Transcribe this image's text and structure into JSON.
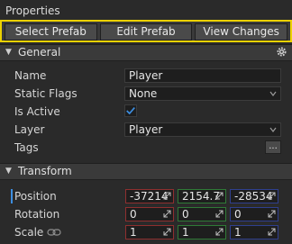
{
  "panel": {
    "title": "Properties"
  },
  "prefab_bar": {
    "select_label": "Select Prefab",
    "edit_label": "Edit Prefab",
    "view_label": "View Changes"
  },
  "general": {
    "header": "General",
    "name_label": "Name",
    "name_value": "Player",
    "static_flags_label": "Static Flags",
    "static_flags_value": "None",
    "is_active_label": "Is Active",
    "is_active_checked": true,
    "layer_label": "Layer",
    "layer_value": "Player",
    "tags_label": "Tags",
    "tags_button": "..."
  },
  "transform": {
    "header": "Transform",
    "position_label": "Position",
    "position": {
      "x": "-37214",
      "y": "2154.7",
      "z": "-28534"
    },
    "rotation_label": "Rotation",
    "rotation": {
      "x": "0",
      "y": "0",
      "z": "0"
    },
    "scale_label": "Scale",
    "scale": {
      "x": "1",
      "y": "1",
      "z": "1"
    }
  },
  "colors": {
    "highlight_border": "#ecd200",
    "accent_blue": "#3d8ee0",
    "x_axis": "#8e2f2f",
    "y_axis": "#2f7a37",
    "z_axis": "#2f3f8e"
  },
  "icons": {
    "gear": "gear-icon",
    "chevron": "chevron-down-icon",
    "check": "checkmark-icon",
    "drag_arrow": "resize-arrow-icon",
    "link": "link-icon"
  }
}
